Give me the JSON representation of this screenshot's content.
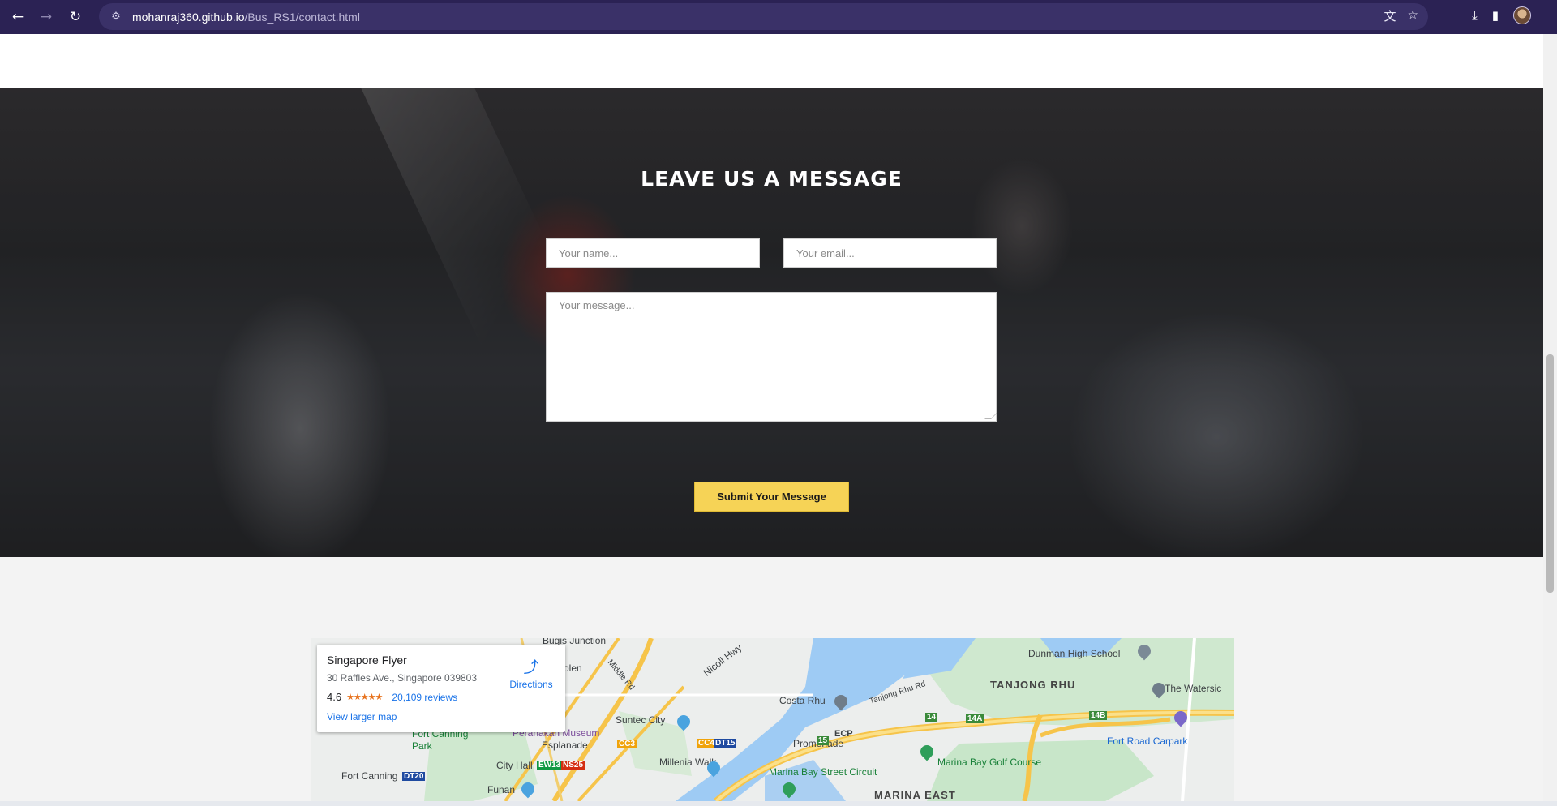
{
  "browser": {
    "url_host": "mohanraj360.github.io",
    "url_path": "/Bus_RS1/contact.html",
    "icons": [
      "back-icon",
      "forward-icon",
      "reload-icon",
      "site-info-icon",
      "translate-icon",
      "bookmark-star-icon",
      "download-icon",
      "side-panel-icon",
      "profile-avatar"
    ]
  },
  "contact": {
    "title": "LEAVE US A MESSAGE",
    "name_placeholder": "Your name...",
    "email_placeholder": "Your email...",
    "message_placeholder": "Your message...",
    "submit_label": "Submit Your Message",
    "submit_color": "#f6d356"
  },
  "map": {
    "place_name": "Singapore Flyer",
    "address": "30 Raffles Ave., Singapore 039803",
    "rating": "4.6",
    "stars": "★★★★★",
    "reviews": "20,109 reviews",
    "directions_label": "Directions",
    "larger_map_label": "View larger map",
    "labels": {
      "bugis": "Bugis Junction",
      "bencoolen": "olen",
      "nicoll": "Nicoll Hwy",
      "middle": "Middle Rd",
      "suntec": "Suntec City",
      "peranakan": "Peranakan Museum",
      "esplanade": "Esplanade",
      "promenade": "Promenade",
      "fortcanning_park": "Fort Canning Park",
      "fortcanning": "Fort Canning",
      "cityhall": "City Hall",
      "millenia": "Millenia Walk",
      "funan": "Funan",
      "costa": "Costa Rhu",
      "tanjongrd": "Tanjong Rhu Rd",
      "tanjong": "TANJONG RHU",
      "dunman": "Dunman High School",
      "watersic": "The Watersic",
      "fortroad": "Fort Road Carpark",
      "golf": "Marina Bay Golf Course",
      "circuit": "Marina Bay Street Circuit",
      "marinaeast": "MARINA EAST",
      "ecp": "ECP",
      "hw14": "14",
      "hw14a": "14A",
      "hw14b": "14B",
      "hw15": "15"
    },
    "stations": {
      "cc4": "CC4",
      "dt15": "DT15",
      "cc3": "CC3",
      "ew13": "EW13",
      "ns25": "NS25",
      "dt20": "DT20"
    }
  }
}
